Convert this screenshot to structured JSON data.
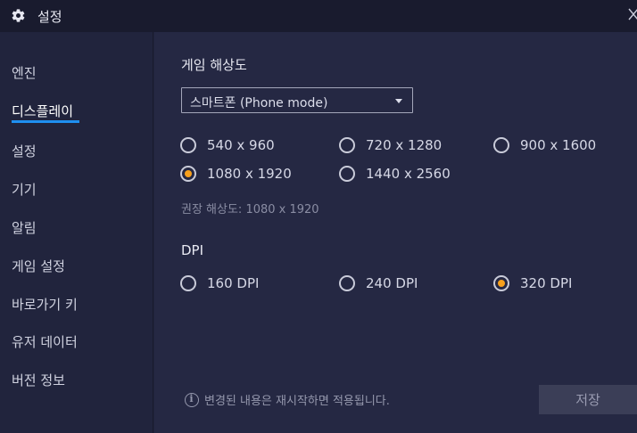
{
  "window": {
    "title": "설정",
    "title_icon": "gear-icon",
    "close_icon": "close-icon"
  },
  "sidebar": {
    "items": [
      {
        "label": "엔진"
      },
      {
        "label": "디스플레이",
        "active": true
      },
      {
        "label": "설정"
      },
      {
        "label": "기기"
      },
      {
        "label": "알림"
      },
      {
        "label": "게임 설정"
      },
      {
        "label": "바로가기 키"
      },
      {
        "label": "유저 데이터"
      },
      {
        "label": "버전 정보"
      }
    ],
    "active_underline_color": "#1f8ff0"
  },
  "resolution": {
    "title": "게임 해상도",
    "mode_selected": "스마트폰 (Phone mode)",
    "options": [
      {
        "label": "540 x 960",
        "checked": false
      },
      {
        "label": "720 x 1280",
        "checked": false
      },
      {
        "label": "900 x 1600",
        "checked": false
      },
      {
        "label": "1080 x 1920",
        "checked": true
      },
      {
        "label": "1440 x 2560",
        "checked": false
      }
    ],
    "recommended": "권장 해상도: 1080 x 1920"
  },
  "dpi": {
    "title": "DPI",
    "options": [
      {
        "label": "160 DPI",
        "checked": false
      },
      {
        "label": "240 DPI",
        "checked": false
      },
      {
        "label": "320 DPI",
        "checked": true
      }
    ]
  },
  "footer": {
    "note": "변경된 내용은 재시작하면 적용됩니다.",
    "save_label": "저장"
  },
  "colors": {
    "accent": "#f7a01c",
    "background": "#252843",
    "sidebar": "#21243d"
  }
}
